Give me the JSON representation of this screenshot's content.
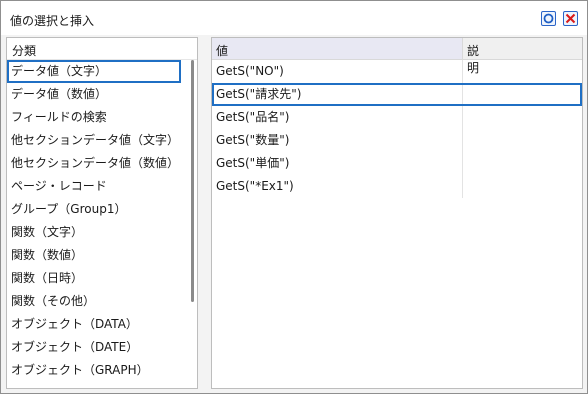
{
  "window": {
    "title": "値の選択と挿入"
  },
  "titlebar": {
    "ok_icon": "circle-icon",
    "close_icon": "x-icon",
    "ok_color": "#1f5fc4",
    "close_color": "#d91b1b"
  },
  "categories": {
    "header": "分類",
    "items": [
      {
        "label": "データ値（文字）",
        "selected": true
      },
      {
        "label": "データ値（数値）",
        "selected": false
      },
      {
        "label": "フィールドの検索",
        "selected": false
      },
      {
        "label": "他セクションデータ値（文字）",
        "selected": false
      },
      {
        "label": "他セクションデータ値（数値）",
        "selected": false
      },
      {
        "label": "ページ・レコード",
        "selected": false
      },
      {
        "label": "グループ（Group1）",
        "selected": false
      },
      {
        "label": "関数（文字）",
        "selected": false
      },
      {
        "label": "関数（数値）",
        "selected": false
      },
      {
        "label": "関数（日時）",
        "selected": false
      },
      {
        "label": "関数（その他）",
        "selected": false
      },
      {
        "label": "オブジェクト（DATA）",
        "selected": false
      },
      {
        "label": "オブジェクト（DATE）",
        "selected": false
      },
      {
        "label": "オブジェクト（GRAPH）",
        "selected": false
      }
    ]
  },
  "values": {
    "columns": {
      "value": "値",
      "description": "説明"
    },
    "rows": [
      {
        "value": "GetS(\"NO\")",
        "description": "",
        "selected": false
      },
      {
        "value": "GetS(\"請求先\")",
        "description": "",
        "selected": true
      },
      {
        "value": "GetS(\"品名\")",
        "description": "",
        "selected": false
      },
      {
        "value": "GetS(\"数量\")",
        "description": "",
        "selected": false
      },
      {
        "value": "GetS(\"単価\")",
        "description": "",
        "selected": false
      },
      {
        "value": "GetS(\"*Ex1\")",
        "description": "",
        "selected": false
      }
    ]
  }
}
